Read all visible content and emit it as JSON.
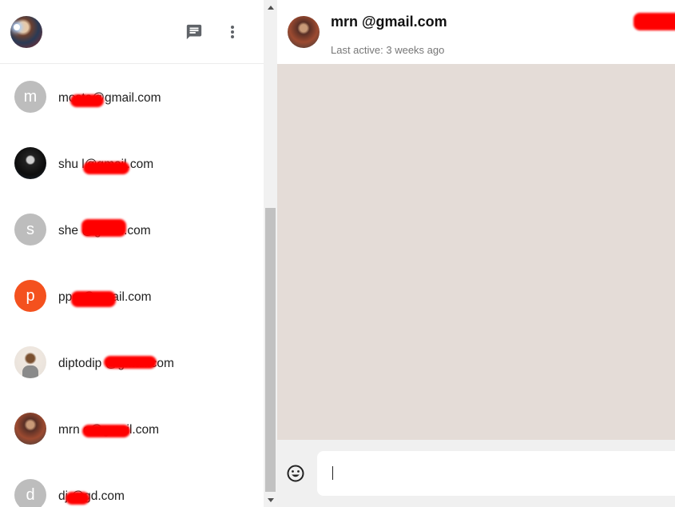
{
  "sidebar": {
    "header": {
      "avatar": "user-avatar",
      "new_chat_icon": "chat-icon",
      "menu_icon": "more-vert-icon"
    },
    "contacts": [
      {
        "initial": "m",
        "email": "mosta@gmail.com",
        "avatar": "grey"
      },
      {
        "initial": "",
        "email": "shu     l@gmail.com",
        "avatar": "photo"
      },
      {
        "initial": "s",
        "email": "she      @gmail.com",
        "avatar": "grey"
      },
      {
        "initial": "p",
        "email": "ppo     @gmail.com",
        "avatar": "orange"
      },
      {
        "initial": "",
        "email": "diptodip      @gmail.com",
        "avatar": "photo"
      },
      {
        "initial": "",
        "email": "mrn      e@gmail.com",
        "avatar": "photo"
      },
      {
        "initial": "d",
        "email": "dj   @gd.com",
        "avatar": "grey"
      }
    ]
  },
  "chat": {
    "peer_name": "mrn      @gmail.com",
    "last_active": "Last active: 3 weeks ago",
    "input_value": "",
    "emoji_icon": "emoji-icon"
  },
  "colors": {
    "messages_bg": "#e4dcd7",
    "composer_bg": "#f0f0f0",
    "orange_avatar": "#f4511e",
    "grey_avatar": "#bdbdbd"
  }
}
